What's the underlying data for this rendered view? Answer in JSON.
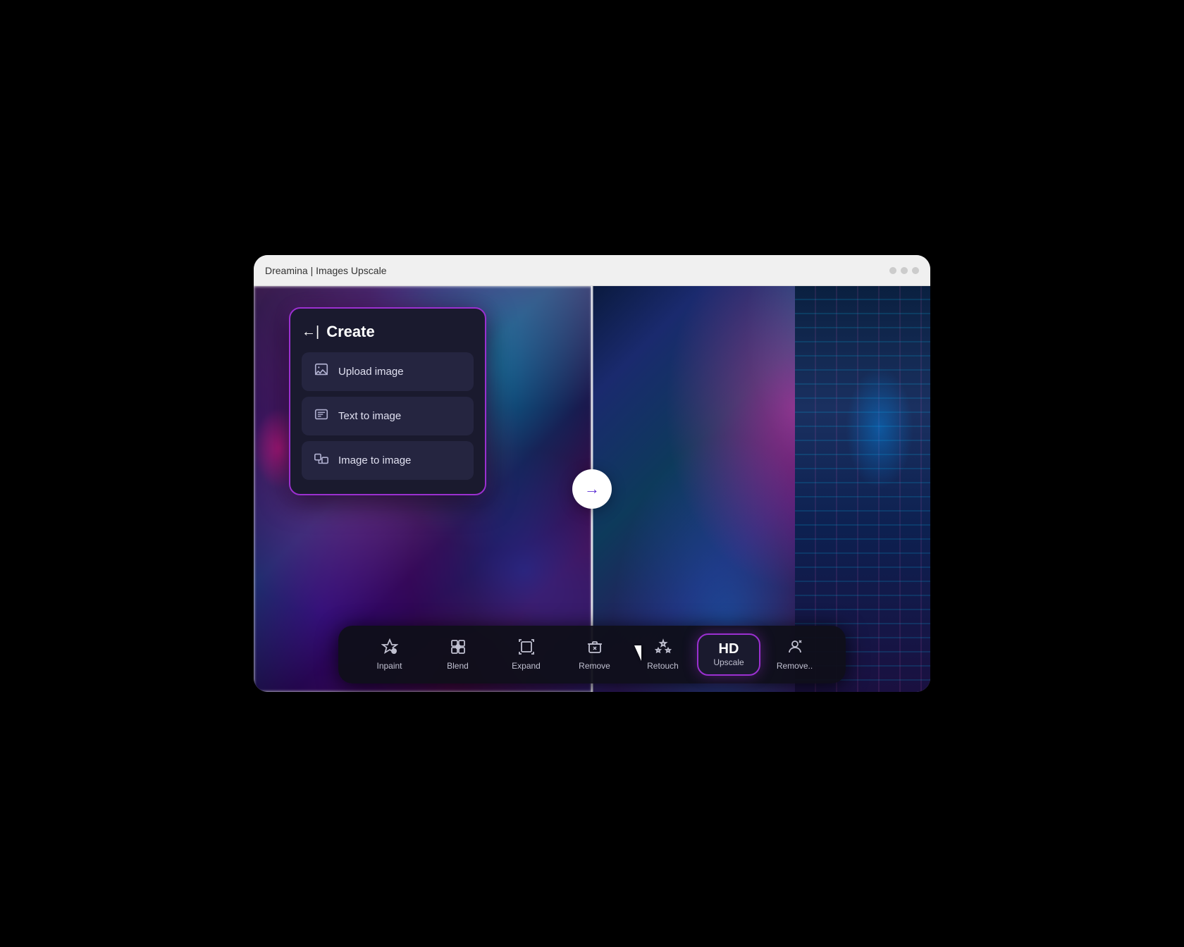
{
  "browser": {
    "title": "Dreamina | Images Upscale",
    "dots": [
      "dot1",
      "dot2",
      "dot3"
    ]
  },
  "create_panel": {
    "back_label": "←|",
    "title": "Create",
    "menu_items": [
      {
        "id": "upload-image",
        "label": "Upload image",
        "icon": "upload-icon"
      },
      {
        "id": "text-to-image",
        "label": "Text to image",
        "icon": "text-image-icon"
      },
      {
        "id": "image-to-image",
        "label": "Image to image",
        "icon": "image-image-icon"
      }
    ]
  },
  "toolbar": {
    "items": [
      {
        "id": "inpaint",
        "label": "Inpaint",
        "icon": "inpaint-icon"
      },
      {
        "id": "blend",
        "label": "Blend",
        "icon": "blend-icon"
      },
      {
        "id": "expand",
        "label": "Expand",
        "icon": "expand-icon"
      },
      {
        "id": "remove",
        "label": "Remove",
        "icon": "remove-icon"
      },
      {
        "id": "retouch",
        "label": "Retouch",
        "icon": "retouch-icon"
      }
    ],
    "hd_upscale": {
      "title": "HD",
      "label": "Upscale"
    },
    "remove_bg": {
      "label": "Remove.."
    }
  },
  "colors": {
    "accent_purple": "#9b30d0",
    "dark_bg": "#1a1a2e",
    "menu_item_bg": "#252540",
    "toolbar_bg": "rgba(15,15,25,0.95)"
  }
}
